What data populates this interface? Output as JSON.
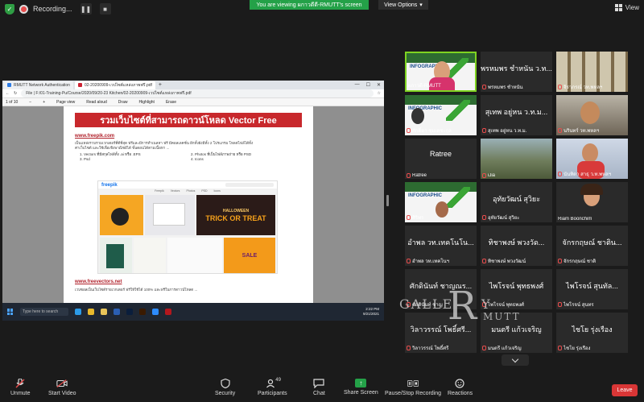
{
  "topbar": {
    "recording_label": "Recording...",
    "banner": "You are viewing ผกาวดีดี-RMUTT's screen",
    "view_options": "View Options",
    "view_label": "View"
  },
  "shared": {
    "tabs": [
      "RMUTT Network Authentication",
      "02-20200909-เวปไซต์แหล่งภาพฟรี.pdf"
    ],
    "url": "File | F:/01-Training-Pu/Course/2020/09/20-23 Kitchen/02-20200909-เวปไซต์แหล่งภาพฟรี.pdf",
    "page_info": "1   of 10",
    "pdf_tools": [
      "Page view",
      "Read aloud",
      "Draw",
      "Highlight",
      "Erase"
    ],
    "pdf_title": "รวมเว็บไซต์ที่สามารถดาวน์โหลด Vector Free",
    "link1": "www.freepik.com",
    "body1": "เป็นแหล่งรวบรวมเวกเตอร์ที่ดีที่สุด ฟรีและมีการทำเนลหา ฟรี มีคอลเลคชั่น อีกทั้งยังมีทั้ง 2 โปรแกรม โหลดไฟล์ได้ทั้ง",
    "body1b": "ค่าเว็บไซต์ และใช้เพื่อเชิงพาณิชย์ได้ ขั้นตอนได้ตามเนื้อหา ...",
    "list": [
      "1. Vectors ที่มีสกุลไฟล์ทั้ง .ai หรือ .EPS",
      "2. Photos ที่เป็นไฟล์ภาพถ่าย หรือ PSD",
      "3. Psd",
      "4. Icons"
    ],
    "freepik_logo": "freepik",
    "freepik_tabs": [
      "Freepik",
      "Vectors",
      "Photos",
      "PSD",
      "Icons"
    ],
    "halloween_line1": "HALLOWEEN",
    "halloween_line2": "TRICK OR TREAT",
    "sale_text": "SALE",
    "link2": "www.freevectors.net",
    "body2": "เวบซอลเป็นเว็บไซต์รายเวกเตอร์ ฟรีให้ใช้ได้ 100% และฟรีในการดาวน์โหลด ...",
    "taskbar_search": "Type here to search",
    "clock_time": "2:22 PM",
    "clock_date": "9/21/2021"
  },
  "gallery": {
    "tiles": [
      {
        "name": "ผกาวดี-RMUTT",
        "type": "poster"
      },
      {
        "name": "พรหมพร ชำหนัน",
        "big": "พรหมพร ชำหนัน ว.ท..."
      },
      {
        "name": "จิราภรณ์ วท.พหลฯ",
        "type": "shelf"
      },
      {
        "name": "ศักดิ์ดา ชุมเตชะกุล",
        "type": "poster"
      },
      {
        "name": "สุเทพ อยู่หน ว.ท.ม.",
        "big": "สุเทพ อยู่หน ว.ท.ม..."
      },
      {
        "name": "นรินทร์ วท.พหลฯ",
        "type": "indoor"
      },
      {
        "name": "Ratree",
        "big": "Ratree"
      },
      {
        "name": "iJia",
        "type": "outdoor"
      },
      {
        "name": "นันทิดา สาธุ ว.ท.พหลฯ",
        "type": "blue"
      },
      {
        "name": "ศิริพร",
        "type": "poster"
      },
      {
        "name": "อุทัยวัฒน์ สุวิยะ",
        "big": "อุทัยวัฒน์ สุวิยะ"
      },
      {
        "name": "Riam Boonchim",
        "type": "riam"
      },
      {
        "name": "อำพล วท.เทคโนฯ",
        "big": "อำพล วท.เทคโนโน..."
      },
      {
        "name": "ทิชาพงษ์ พวงวัฒน์",
        "big": "ทิชาพงษ์ พวงวัด..."
      },
      {
        "name": "จักรกฤษณ์ ชาติ",
        "big": "จักรกฤษณ์ ชาติน..."
      },
      {
        "name": "ศักดินันท์ ชาญ",
        "big": "ศักดินันท์ ชาญณร..."
      },
      {
        "name": "ไพโรจน์ พุทธพงศ์",
        "big": "ไพโรจน์ พุทธพงศ์"
      },
      {
        "name": "ไพโรจน์ สุนทร",
        "big": "ไพโรจน์ สุนทัล..."
      },
      {
        "name": "วิลาวรรณ์ โพธิ์ศรี",
        "big": "วิลาวรรณ์ โพธิ์ศรี..."
      },
      {
        "name": "มนตรี แก้วเจริญ",
        "big": "มนตรี แก้วเจริญ"
      },
      {
        "name": "ไชโย รุ่งเรือง",
        "big": "ไชโย รุ่งเรือง"
      }
    ]
  },
  "watermark": {
    "gal": "GALLE",
    "r": "R",
    "y": "Y",
    "mutt": "MUTT"
  },
  "toolbar": {
    "unmute": "Unmute",
    "start_video": "Start Video",
    "security": "Security",
    "participants": "Participants",
    "participant_count": "49",
    "chat": "Chat",
    "share_screen": "Share Screen",
    "pause_record": "Pause/Stop Recording",
    "reactions": "Reactions",
    "leave": "Leave"
  }
}
